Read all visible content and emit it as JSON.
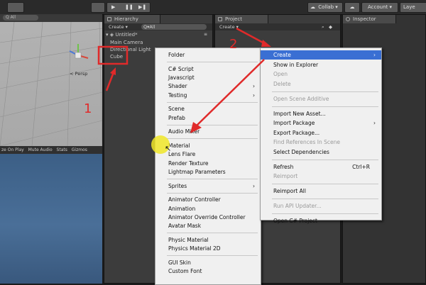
{
  "toolbar": {
    "collab_label": "Collab ▾",
    "account_label": "Account",
    "layers_label": "Laye"
  },
  "scene": {
    "toolbar_search": "All",
    "persp_label": "< Persp"
  },
  "game": {
    "toolbar_items": [
      "ze On Play",
      "Mute Audio",
      "Stats",
      "Gizmos"
    ]
  },
  "hierarchy": {
    "tab_label": "Hierarchy",
    "create_label": "Create ▾",
    "search_placeholder": "Q▾All",
    "scene_name": "Untitled*",
    "items": [
      "Main Camera",
      "Directional Light",
      "Cube"
    ]
  },
  "project": {
    "tab_label": "Project",
    "create_label": "Create ▾"
  },
  "inspector": {
    "tab_label": "Inspector"
  },
  "create_menu": {
    "items": [
      {
        "label": "Folder",
        "type": "item"
      },
      {
        "type": "sep"
      },
      {
        "label": "C# Script",
        "type": "item"
      },
      {
        "label": "Javascript",
        "type": "item"
      },
      {
        "label": "Shader",
        "type": "item",
        "arrow": "›"
      },
      {
        "label": "Testing",
        "type": "item",
        "arrow": "›"
      },
      {
        "type": "sep"
      },
      {
        "label": "Scene",
        "type": "item"
      },
      {
        "label": "Prefab",
        "type": "item"
      },
      {
        "type": "sep"
      },
      {
        "label": "Audio Mixer",
        "type": "item"
      },
      {
        "type": "sep"
      },
      {
        "label": "Material",
        "type": "item"
      },
      {
        "label": "Lens Flare",
        "type": "item"
      },
      {
        "label": "Render Texture",
        "type": "item"
      },
      {
        "label": "Lightmap Parameters",
        "type": "item"
      },
      {
        "type": "sep"
      },
      {
        "label": "Sprites",
        "type": "item",
        "arrow": "›"
      },
      {
        "type": "sep"
      },
      {
        "label": "Animator Controller",
        "type": "item"
      },
      {
        "label": "Animation",
        "type": "item"
      },
      {
        "label": "Animator Override Controller",
        "type": "item"
      },
      {
        "label": "Avatar Mask",
        "type": "item"
      },
      {
        "type": "sep"
      },
      {
        "label": "Physic Material",
        "type": "item"
      },
      {
        "label": "Physics Material 2D",
        "type": "item"
      },
      {
        "type": "sep"
      },
      {
        "label": "GUI Skin",
        "type": "item"
      },
      {
        "label": "Custom Font",
        "type": "item"
      }
    ]
  },
  "assets_menu": {
    "items": [
      {
        "label": "Create",
        "type": "item",
        "arrow": "›",
        "highlight": true
      },
      {
        "label": "Show in Explorer",
        "type": "item"
      },
      {
        "label": "Open",
        "type": "item",
        "disabled": true
      },
      {
        "label": "Delete",
        "type": "item",
        "disabled": true
      },
      {
        "type": "sep"
      },
      {
        "label": "Open Scene Additive",
        "type": "item",
        "disabled": true
      },
      {
        "type": "sep"
      },
      {
        "label": "Import New Asset...",
        "type": "item"
      },
      {
        "label": "Import Package",
        "type": "item",
        "arrow": "›"
      },
      {
        "label": "Export Package...",
        "type": "item"
      },
      {
        "label": "Find References In Scene",
        "type": "item",
        "disabled": true
      },
      {
        "label": "Select Dependencies",
        "type": "item"
      },
      {
        "type": "sep"
      },
      {
        "label": "Refresh",
        "type": "item",
        "shortcut": "Ctrl+R"
      },
      {
        "label": "Reimport",
        "type": "item",
        "disabled": true
      },
      {
        "type": "sep"
      },
      {
        "label": "Reimport All",
        "type": "item"
      },
      {
        "type": "sep"
      },
      {
        "label": "Run API Updater...",
        "type": "item",
        "disabled": true
      },
      {
        "type": "sep"
      },
      {
        "label": "Open C# Project",
        "type": "item"
      }
    ]
  },
  "annotations": {
    "step1": "1",
    "step2": "2",
    "color": "#e02a2a"
  },
  "colors": {
    "menu_bg": "#f0f0f0",
    "menu_highlight": "#3a6fd3",
    "panel_bg": "#3c3c3c"
  }
}
